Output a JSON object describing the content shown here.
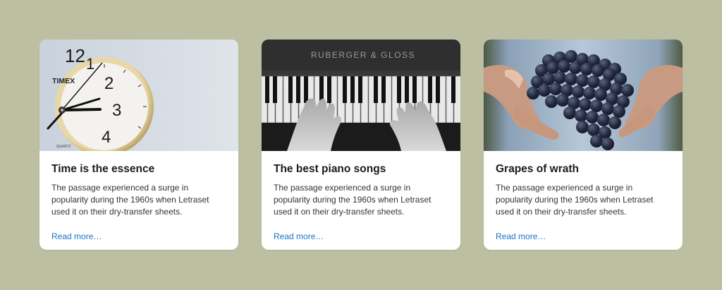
{
  "cards": [
    {
      "image": "clock-photo",
      "clock_brand": "TIMEX",
      "clock_sub": "QUARTZ",
      "numerals": [
        "12",
        "1",
        "2",
        "3",
        "4"
      ],
      "title": "Time is the essence",
      "text": "The passage experienced a surge in popularity during the 1960s when Letraset used it on their dry-transfer sheets.",
      "link": "Read more…"
    },
    {
      "image": "piano-photo",
      "piano_brand": "RUBERGER & GLOSS",
      "title": "The best piano songs",
      "text": "The passage experienced a surge in popularity during the 1960s when Letraset used it on their dry-transfer sheets.",
      "link": "Read more…"
    },
    {
      "image": "grapes-photo",
      "title": "Grapes of wrath",
      "text": "The passage experienced a surge in popularity during the 1960s when Letraset used it on their dry-transfer sheets.",
      "link": "Read more…"
    }
  ],
  "colors": {
    "background": "#bdbfa2",
    "card": "#ffffff",
    "link": "#1a73c9"
  }
}
